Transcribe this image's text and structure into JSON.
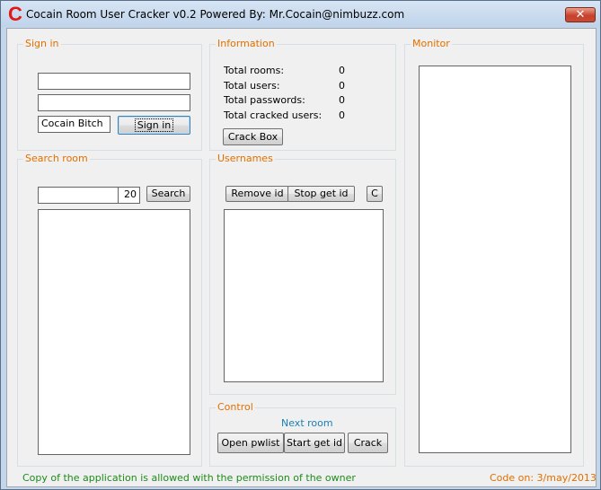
{
  "window": {
    "icon_letter": "C",
    "title": "Cocain Room User Cracker v0.2    Powered By: Mr.Cocain@nimbuzz.com",
    "close_symbol": "✕"
  },
  "sign_in": {
    "group_title": "Sign in",
    "username_value": "",
    "password_value": "",
    "status_value": "Cocain Bitch",
    "sign_in_button": "Sign in"
  },
  "information": {
    "group_title": "Information",
    "stats": [
      {
        "label": "Total rooms:",
        "value": "0"
      },
      {
        "label": "Total users:",
        "value": "0"
      },
      {
        "label": "Total passwords:",
        "value": "0"
      },
      {
        "label": "Total cracked users:",
        "value": "0"
      }
    ],
    "crack_box_button": "Crack Box"
  },
  "monitor": {
    "group_title": "Monitor"
  },
  "search_room": {
    "group_title": "Search room",
    "query_value": "",
    "count_value": "20",
    "search_button": "Search"
  },
  "usernames": {
    "group_title": "Usernames",
    "remove_id_button": "Remove id",
    "stop_get_id_button": "Stop get id",
    "c_button": "C"
  },
  "control": {
    "group_title": "Control",
    "next_room_label": "Next room",
    "open_pwlist_button": "Open pwlist",
    "start_get_id_button": "Start get id",
    "crack_button": "Crack"
  },
  "footer": {
    "left_text": "Copy of the application is allowed with the permission of the owner",
    "right_text": "Code on: 3/may/2013"
  },
  "colors": {
    "group_label": "#e07000",
    "footer_left": "#1e8a1e",
    "next_room": "#1a7fb4",
    "app_icon": "#e01818"
  }
}
